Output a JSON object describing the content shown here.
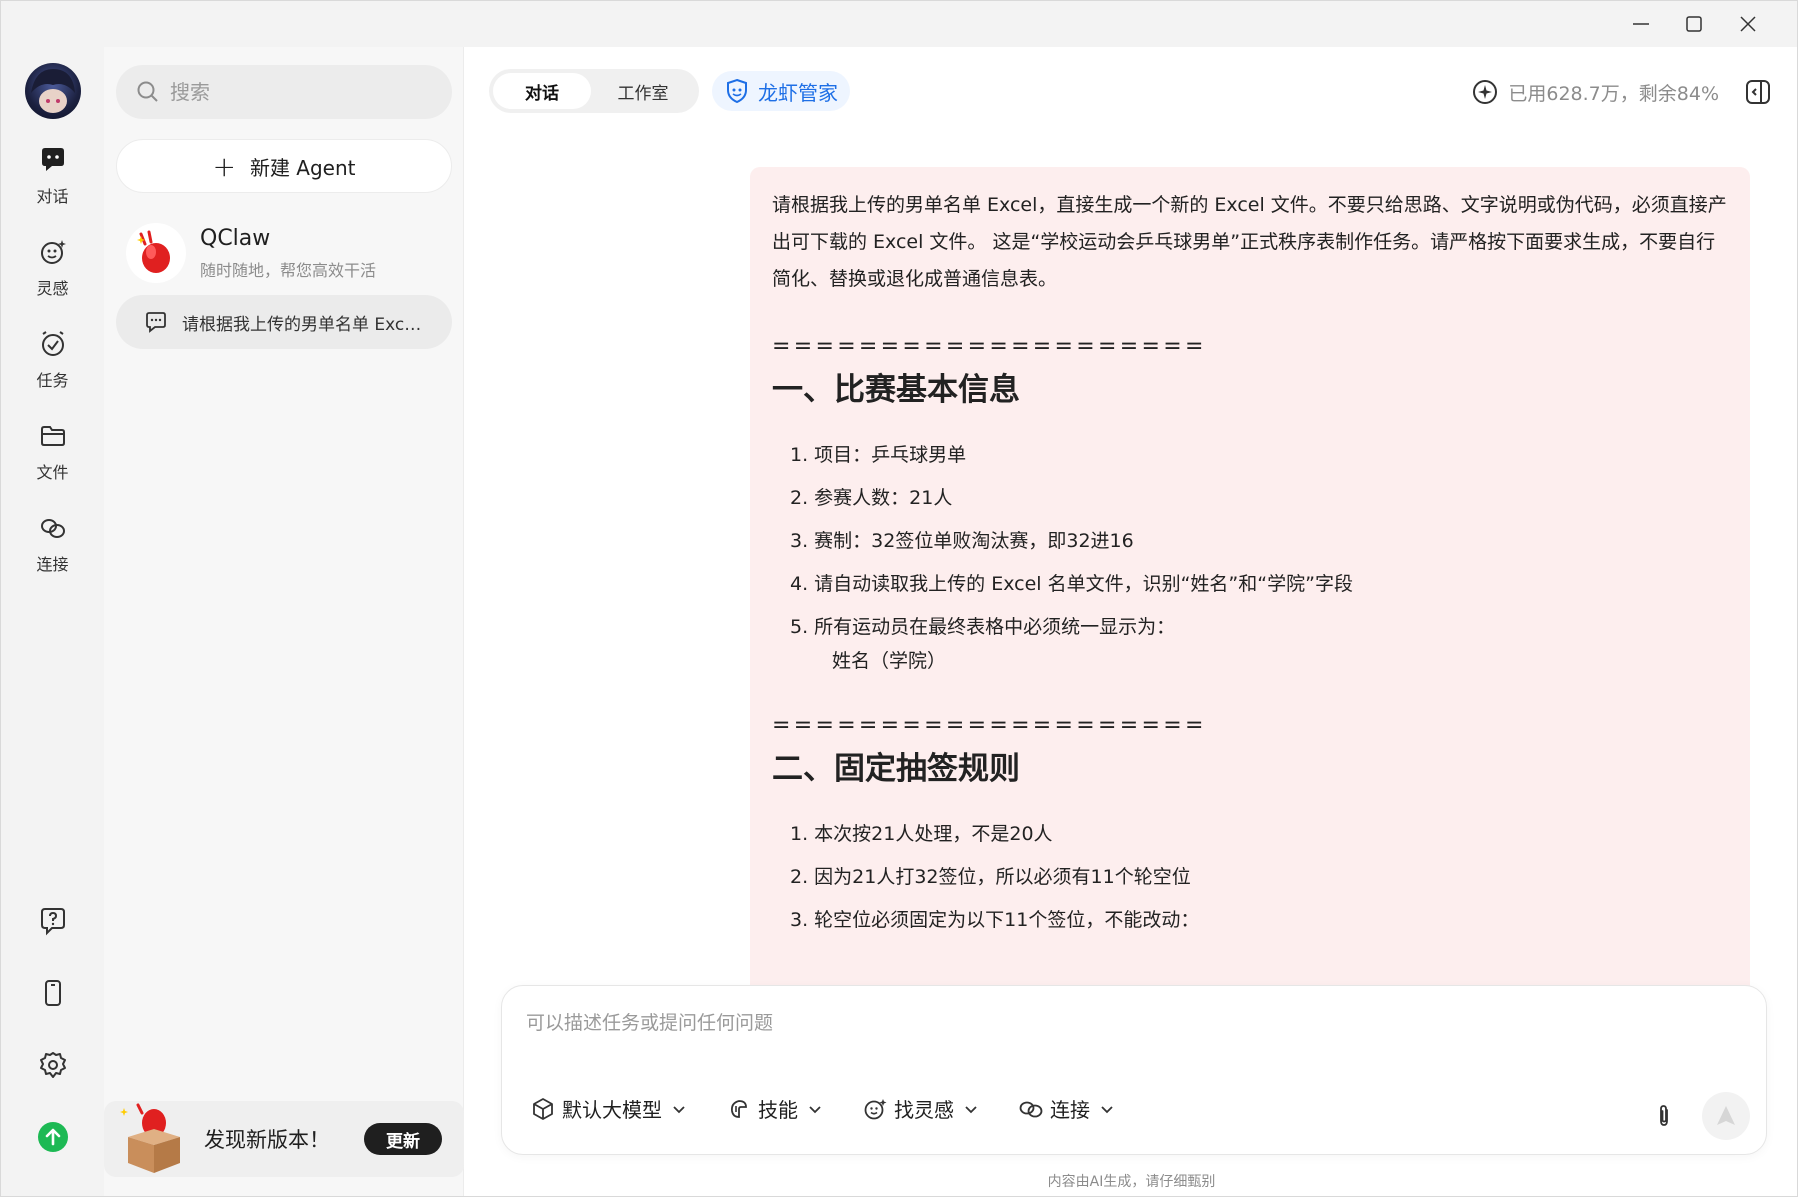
{
  "rail": {
    "items": [
      {
        "label": "对话",
        "icon": "chat-bubble-icon"
      },
      {
        "label": "灵感",
        "icon": "sparkle-face-icon"
      },
      {
        "label": "任务",
        "icon": "alarm-check-icon"
      },
      {
        "label": "文件",
        "icon": "folder-icon"
      },
      {
        "label": "连接",
        "icon": "link-icon"
      }
    ],
    "bottom": [
      "help-icon",
      "phone-icon",
      "gear-icon",
      "upgrade-icon"
    ]
  },
  "sidebar": {
    "search_placeholder": "搜索",
    "new_agent_label": "新建 Agent",
    "agent": {
      "name": "QClaw",
      "desc": "随时随地，帮您高效干活"
    },
    "chat_item": "请根据我上传的男单名单 Excel，直接生成一个新的 Excel 文件",
    "update": {
      "message": "发现新版本！",
      "button": "更新"
    }
  },
  "header": {
    "tabs": [
      {
        "label": "对话",
        "active": true
      },
      {
        "label": "工作室",
        "active": false
      }
    ],
    "butler": "龙虾管家",
    "usage": "已用628.7万，剩余84%"
  },
  "message": {
    "intro": "请根据我上传的男单名单 Excel，直接生成一个新的 Excel 文件。不要只给思路、文字说明或伪代码，必须直接产出可下载的 Excel 文件。 这是“学校运动会乒乓球男单”正式秩序表制作任务。请严格按下面要求生成，不要自行简化、替换或退化成普通信息表。",
    "separator": "====================",
    "section1": {
      "title": "一、比赛基本信息",
      "items": [
        "项目：乒乓球男单",
        "参赛人数：21人",
        "赛制：32签位单败淘汰赛，即32进16",
        "请自动读取我上传的 Excel 名单文件，识别“姓名”和“学院”字段",
        "所有运动员在最终表格中必须统一显示为："
      ],
      "item5_sub": "姓名（学院）"
    },
    "section2": {
      "title": "二、固定抽签规则",
      "items": [
        "本次按21人处理，不是20人",
        "因为21人打32签位，所以必须有11个轮空位",
        "轮空位必须固定为以下11个签位，不能改动："
      ]
    }
  },
  "composer": {
    "placeholder": "可以描述任务或提问任何问题",
    "tools": [
      {
        "label": "默认大模型",
        "icon": "cube-icon"
      },
      {
        "label": "技能",
        "icon": "skill-icon"
      },
      {
        "label": "找灵感",
        "icon": "sparkle-face-icon"
      },
      {
        "label": "连接",
        "icon": "link-icon"
      }
    ]
  },
  "disclaimer": "内容由AI生成，请仔细甄别",
  "colors": {
    "accent": "#1e6fe6",
    "bubble": "#fdeeee",
    "upgrade": "#1db954"
  }
}
